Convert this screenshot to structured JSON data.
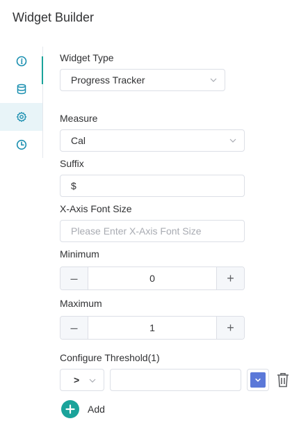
{
  "header": {
    "title": "Widget Builder"
  },
  "nav": {
    "items": [
      {
        "icon": "info-icon"
      },
      {
        "icon": "database-icon"
      },
      {
        "icon": "gear-icon",
        "active": true
      },
      {
        "icon": "clock-icon"
      }
    ]
  },
  "form": {
    "widget_type": {
      "label": "Widget Type",
      "value": "Progress Tracker"
    },
    "measure": {
      "label": "Measure",
      "value": "Cal"
    },
    "suffix": {
      "label": "Suffix",
      "value": "$"
    },
    "x_axis_font_size": {
      "label": "X-Axis Font Size",
      "placeholder": "Please Enter X-Axis Font Size"
    },
    "minimum": {
      "label": "Minimum",
      "value": "0",
      "decrement": "–",
      "increment": "+"
    },
    "maximum": {
      "label": "Maximum",
      "value": "1",
      "decrement": "–",
      "increment": "+"
    },
    "threshold": {
      "label": "Configure Threshold(1)",
      "operator": ">",
      "value": "",
      "color": "#5b78d8"
    },
    "add_label": "Add"
  },
  "colors": {
    "accent": "#1aa39a",
    "icon": "#1a8fb0",
    "add_button": "#1aa39a"
  }
}
